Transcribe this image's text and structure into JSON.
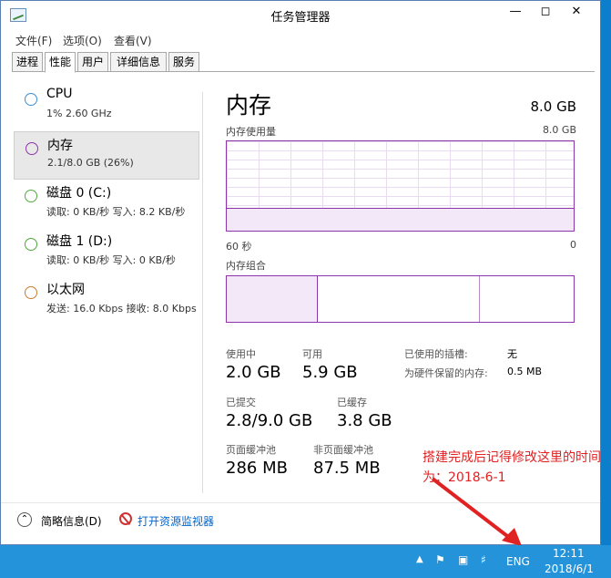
{
  "window": {
    "title": "任务管理器"
  },
  "menu": [
    "文件(F)",
    "选项(O)",
    "查看(V)"
  ],
  "tabs": [
    "进程",
    "性能",
    "用户",
    "详细信息",
    "服务"
  ],
  "sidebar": [
    {
      "name": "CPU",
      "sub": "1% 2.60 GHz",
      "color": "#3c8ed0"
    },
    {
      "name": "内存",
      "sub": "2.1/8.0 GB (26%)",
      "color": "#8b35a8"
    },
    {
      "name": "磁盘 0 (C:)",
      "sub": "读取: 0 KB/秒  写入: 8.2 KB/秒",
      "color": "#4fa83d"
    },
    {
      "name": "磁盘 1 (D:)",
      "sub": "读取: 0 KB/秒  写入: 0 KB/秒",
      "color": "#4fa83d"
    },
    {
      "name": "以太网",
      "sub": "发送: 16.0 Kbps  接收: 8.0 Kbps",
      "color": "#c77d32"
    }
  ],
  "memory": {
    "title": "内存",
    "total": "8.0 GB",
    "usage_label": "内存使用量",
    "usage_max": "8.0 GB",
    "x_left": "60 秒",
    "x_right": "0",
    "usage_fraction": 0.26,
    "composition_label": "内存组合",
    "stats": {
      "in_use_label": "使用中",
      "in_use": "2.0 GB",
      "avail_label": "可用",
      "avail": "5.9 GB",
      "slots_label": "已使用的插槽:",
      "slots": "无",
      "hw_label": "为硬件保留的内存:",
      "hw": "0.5 MB",
      "committed_label": "已提交",
      "committed": "2.8/9.0 GB",
      "cached_label": "已缓存",
      "cached": "3.8 GB",
      "paged_label": "页面缓冲池",
      "paged": "286 MB",
      "nonpaged_label": "非页面缓冲池",
      "nonpaged": "87.5 MB"
    }
  },
  "footer": {
    "brief": "简略信息(D)",
    "monitor": "打开资源监视器"
  },
  "annotation": "搭建完成后记得修改这里的时间为：2018-6-1",
  "taskbar": {
    "lang": "ENG",
    "time": "12:11",
    "date": "2018/6/1"
  }
}
